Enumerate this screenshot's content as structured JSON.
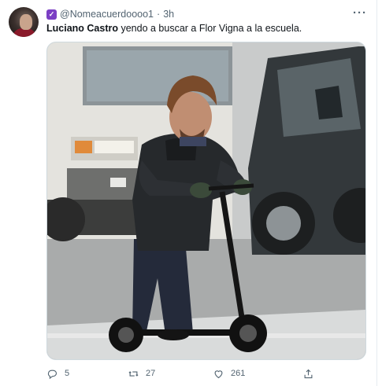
{
  "tweet": {
    "handle": "@Nomeacuerdoooo1",
    "separator": "·",
    "time": "3h",
    "more": "···",
    "author_name": "Luciano Castro",
    "body": " yendo a buscar a Flor Vigna a la escuela."
  },
  "actions": {
    "reply_count": "5",
    "retweet_count": "27",
    "like_count": "261"
  },
  "icons": {
    "reply": "reply-icon",
    "retweet": "retweet-icon",
    "like": "heart-icon",
    "share": "share-icon",
    "badge": "app-badge-icon"
  },
  "colors": {
    "text": "#0f1419",
    "muted": "#536471",
    "badge": "#7b3fc4"
  }
}
